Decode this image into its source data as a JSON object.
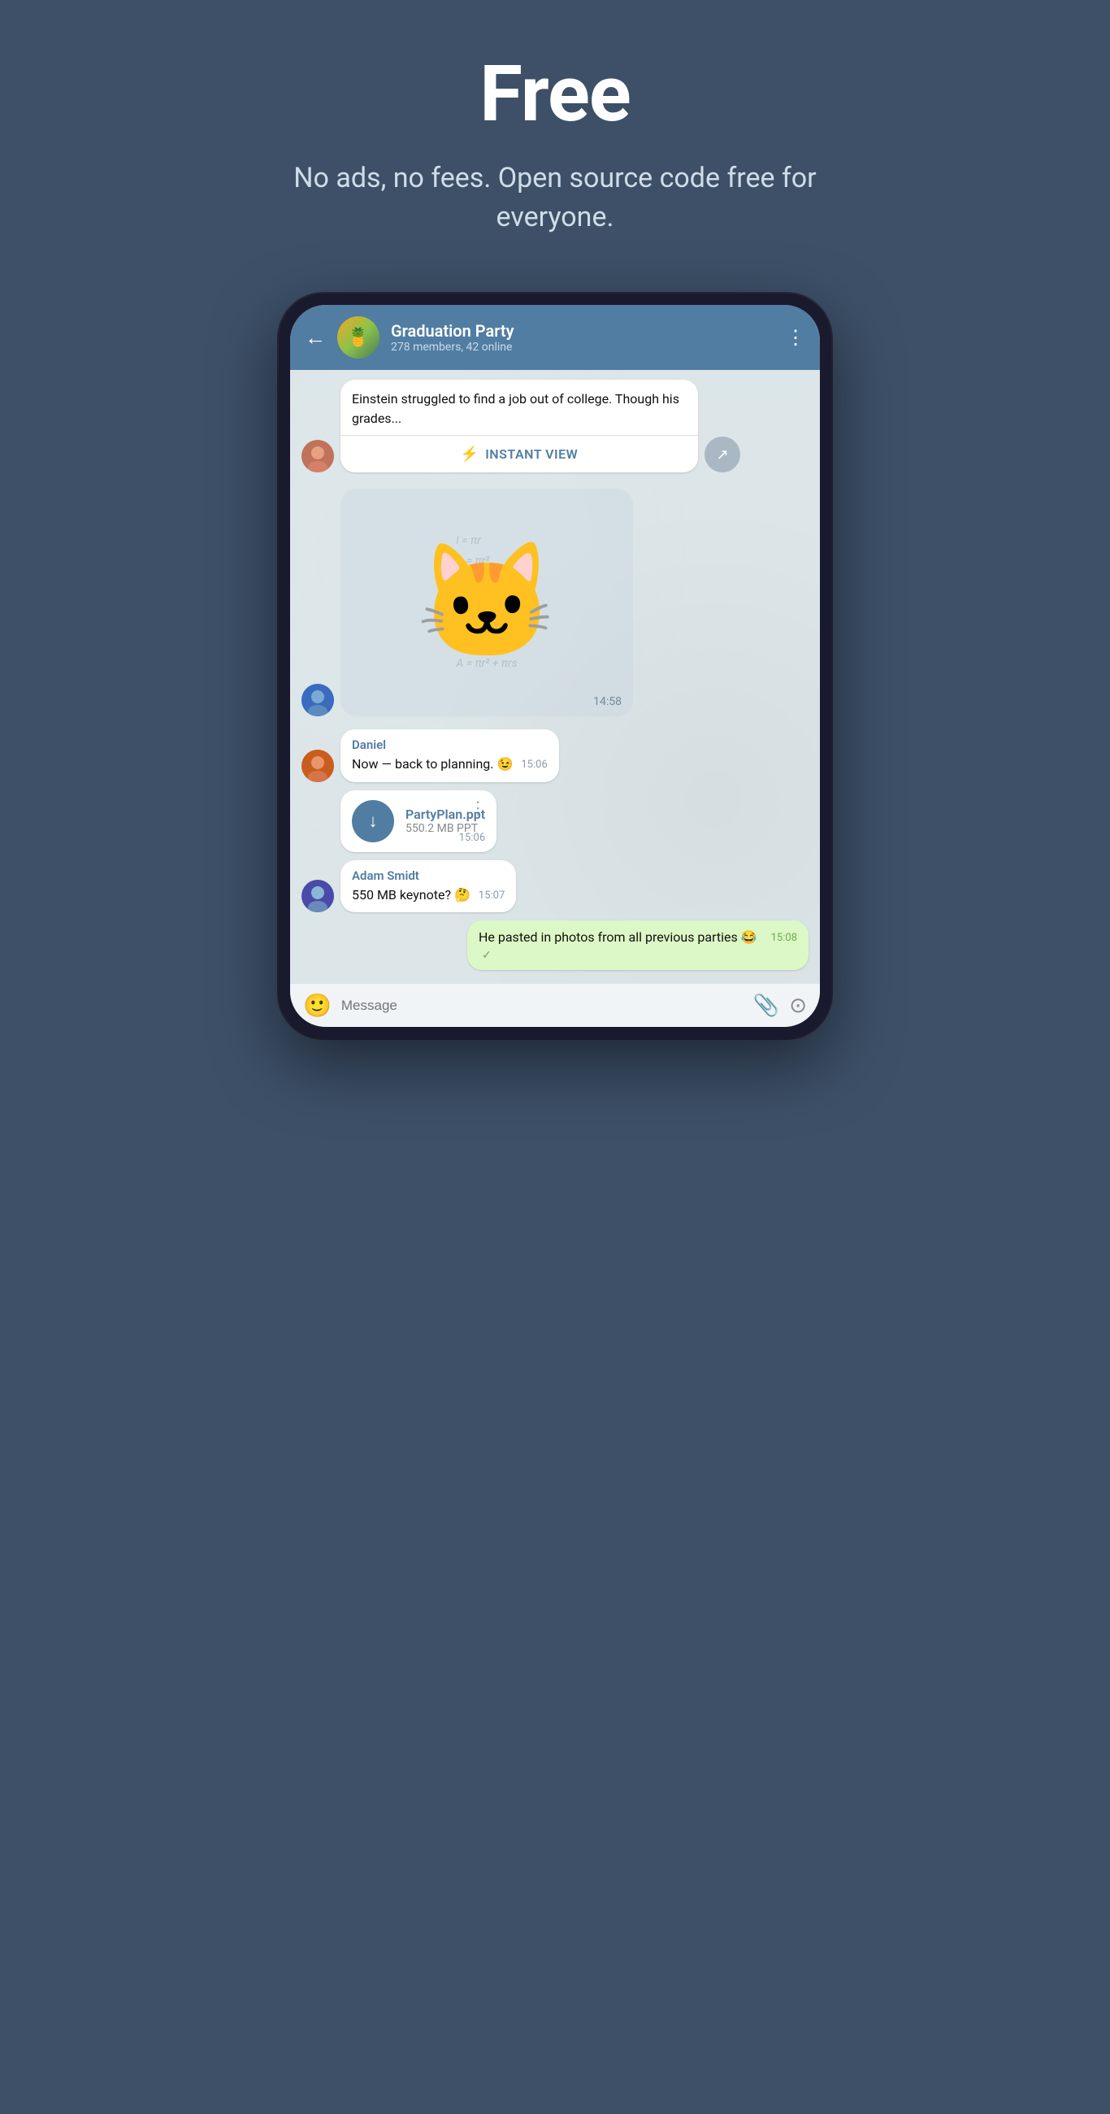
{
  "hero": {
    "title": "Free",
    "subtitle": "No ads, no fees. Open source code free for everyone."
  },
  "header": {
    "group_name": "Graduation Party",
    "members_status": "278 members, 42 online",
    "avatar_emoji": "🍍"
  },
  "messages": [
    {
      "id": "article",
      "type": "article",
      "text": "Einstein struggled to find a job out of college. Though his grades...",
      "instant_view_label": "INSTANT VIEW",
      "avatar_class": "avatar-1"
    },
    {
      "id": "sticker",
      "type": "sticker",
      "time": "14:58",
      "avatar_class": "avatar-2"
    },
    {
      "id": "daniel-msg",
      "type": "text",
      "sender": "Daniel",
      "text": "Now — back to planning. 😉",
      "time": "15:06",
      "avatar_class": "avatar-3"
    },
    {
      "id": "file-msg",
      "type": "file",
      "file_name": "PartyPlan.ppt",
      "file_size": "550.2 MB PPT",
      "time": "15:06",
      "avatar_class": "avatar-3"
    },
    {
      "id": "adam-msg",
      "type": "text",
      "sender": "Adam Smidt",
      "text": "550 MB keynote? 🤔",
      "time": "15:07",
      "avatar_class": "avatar-4"
    },
    {
      "id": "self-msg",
      "type": "self",
      "text": "He pasted in photos from all previous parties 😂",
      "time": "15:08",
      "checkmark": true
    }
  ],
  "input": {
    "placeholder": "Message"
  },
  "colors": {
    "header_bg": "#517da2",
    "chat_bg": "#dce5e8",
    "accent": "#517da2",
    "green_bubble": "#dcf8c6",
    "page_bg": "#3d5068"
  }
}
